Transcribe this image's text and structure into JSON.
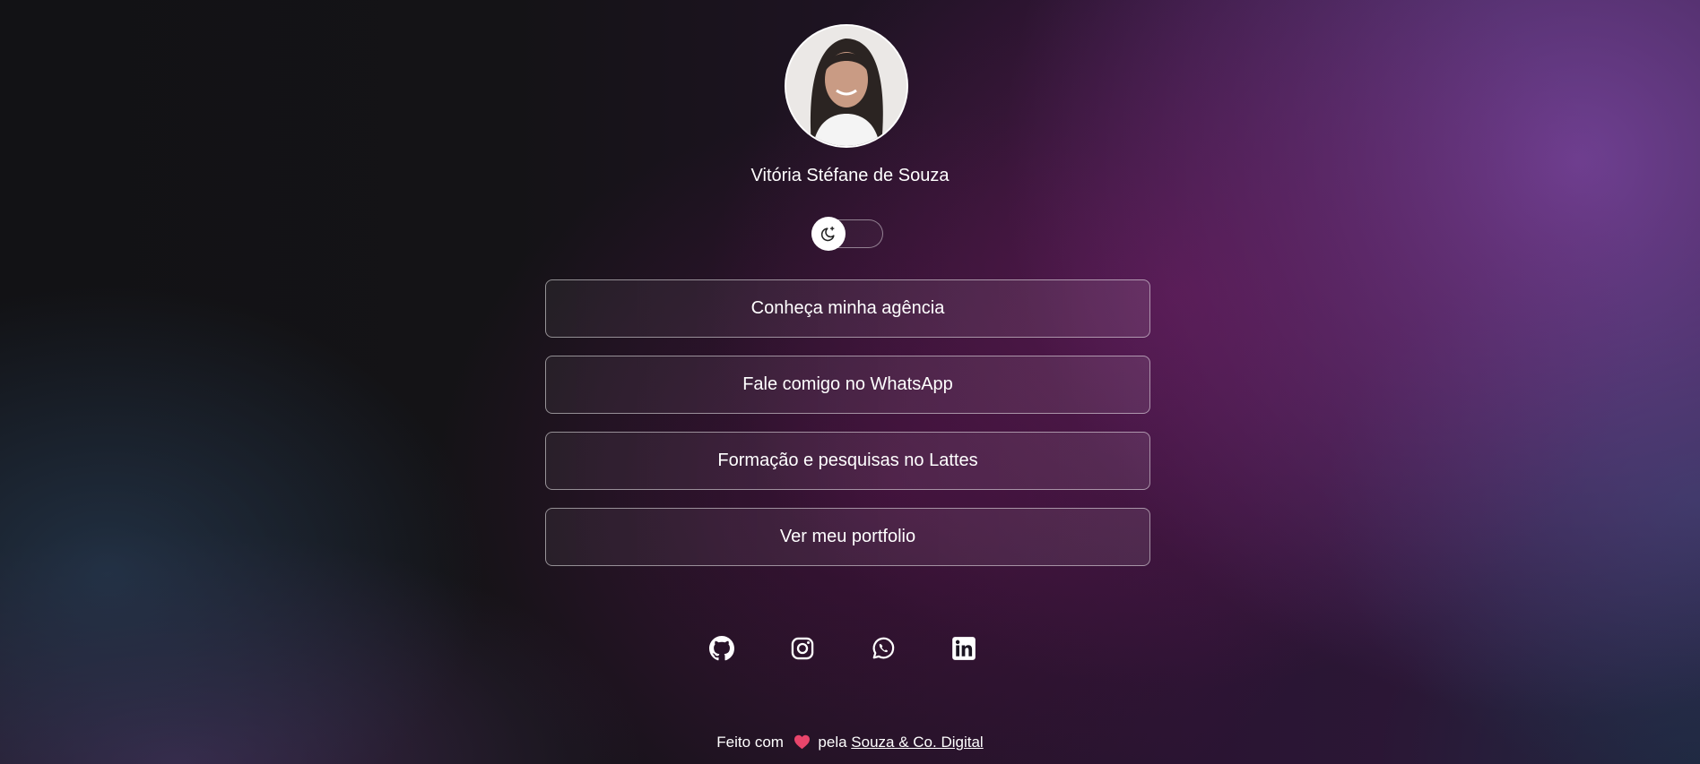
{
  "profile": {
    "name": "Vitória Stéfane de Souza"
  },
  "theme_toggle": {
    "icon": "moon-icon",
    "state": "dark"
  },
  "links": [
    {
      "label": "Conheça minha agência"
    },
    {
      "label": "Fale comigo no WhatsApp"
    },
    {
      "label": "Formação e pesquisas no Lattes"
    },
    {
      "label": "Ver meu portfolio"
    }
  ],
  "socials": [
    {
      "icon": "github-icon"
    },
    {
      "icon": "instagram-icon"
    },
    {
      "icon": "whatsapp-icon"
    },
    {
      "icon": "linkedin-icon"
    }
  ],
  "footer": {
    "prefix": "Feito com",
    "heart_icon": "heart-icon",
    "middle": "pela",
    "link_text": "Souza & Co. Digital"
  },
  "colors": {
    "text": "#ffffff",
    "heart": "#e8456b",
    "accent_purple": "#7a46a0"
  }
}
